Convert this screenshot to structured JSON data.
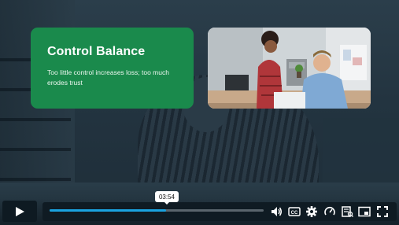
{
  "card": {
    "title": "Control Balance",
    "text": "Too little control increases loss; too much erodes trust"
  },
  "player": {
    "tooltip_time": "03:54",
    "progress_fraction": 0.545
  },
  "controls": {
    "icons": [
      "play-icon",
      "volume-icon",
      "captions-icon",
      "settings-icon",
      "speed-icon",
      "transcript-icon",
      "picture-in-picture-icon",
      "fullscreen-icon"
    ],
    "cc_label": "CC"
  },
  "colors": {
    "card_green": "#1a8a4c",
    "progress_blue": "#1aa3e0"
  }
}
